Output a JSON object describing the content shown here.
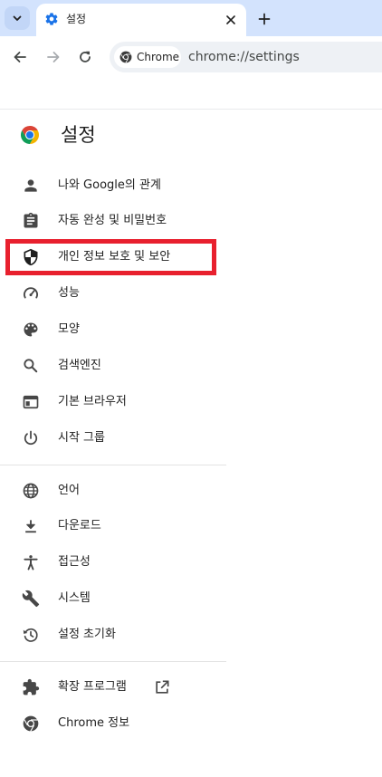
{
  "tab": {
    "title": "설정"
  },
  "omnibox": {
    "chip_label": "Chrome",
    "url": "chrome://settings"
  },
  "settings": {
    "title": "설정"
  },
  "nav": {
    "items": [
      {
        "label": "나와 Google의 관계",
        "icon": "person-icon"
      },
      {
        "label": "자동 완성 및 비밀번호",
        "icon": "clipboard-icon"
      },
      {
        "label": "개인 정보 보호 및 보안",
        "icon": "shield-icon"
      },
      {
        "label": "성능",
        "icon": "speedometer-icon"
      },
      {
        "label": "모양",
        "icon": "palette-icon"
      },
      {
        "label": "검색엔진",
        "icon": "search-icon"
      },
      {
        "label": "기본 브라우저",
        "icon": "browser-window-icon"
      },
      {
        "label": "시작 그룹",
        "icon": "power-icon"
      },
      {
        "label": "언어",
        "icon": "globe-icon"
      },
      {
        "label": "다운로드",
        "icon": "download-icon"
      },
      {
        "label": "접근성",
        "icon": "accessibility-icon"
      },
      {
        "label": "시스템",
        "icon": "wrench-icon"
      },
      {
        "label": "설정 초기화",
        "icon": "history-icon"
      },
      {
        "label": "확장 프로그램",
        "icon": "puzzle-icon"
      },
      {
        "label": "Chrome 정보",
        "icon": "chrome-icon"
      }
    ]
  },
  "colors": {
    "tabstrip_bg": "#d3e3fd",
    "highlight": "#e8202e",
    "icon": "#474747",
    "gear_blue": "#1a73e8"
  }
}
